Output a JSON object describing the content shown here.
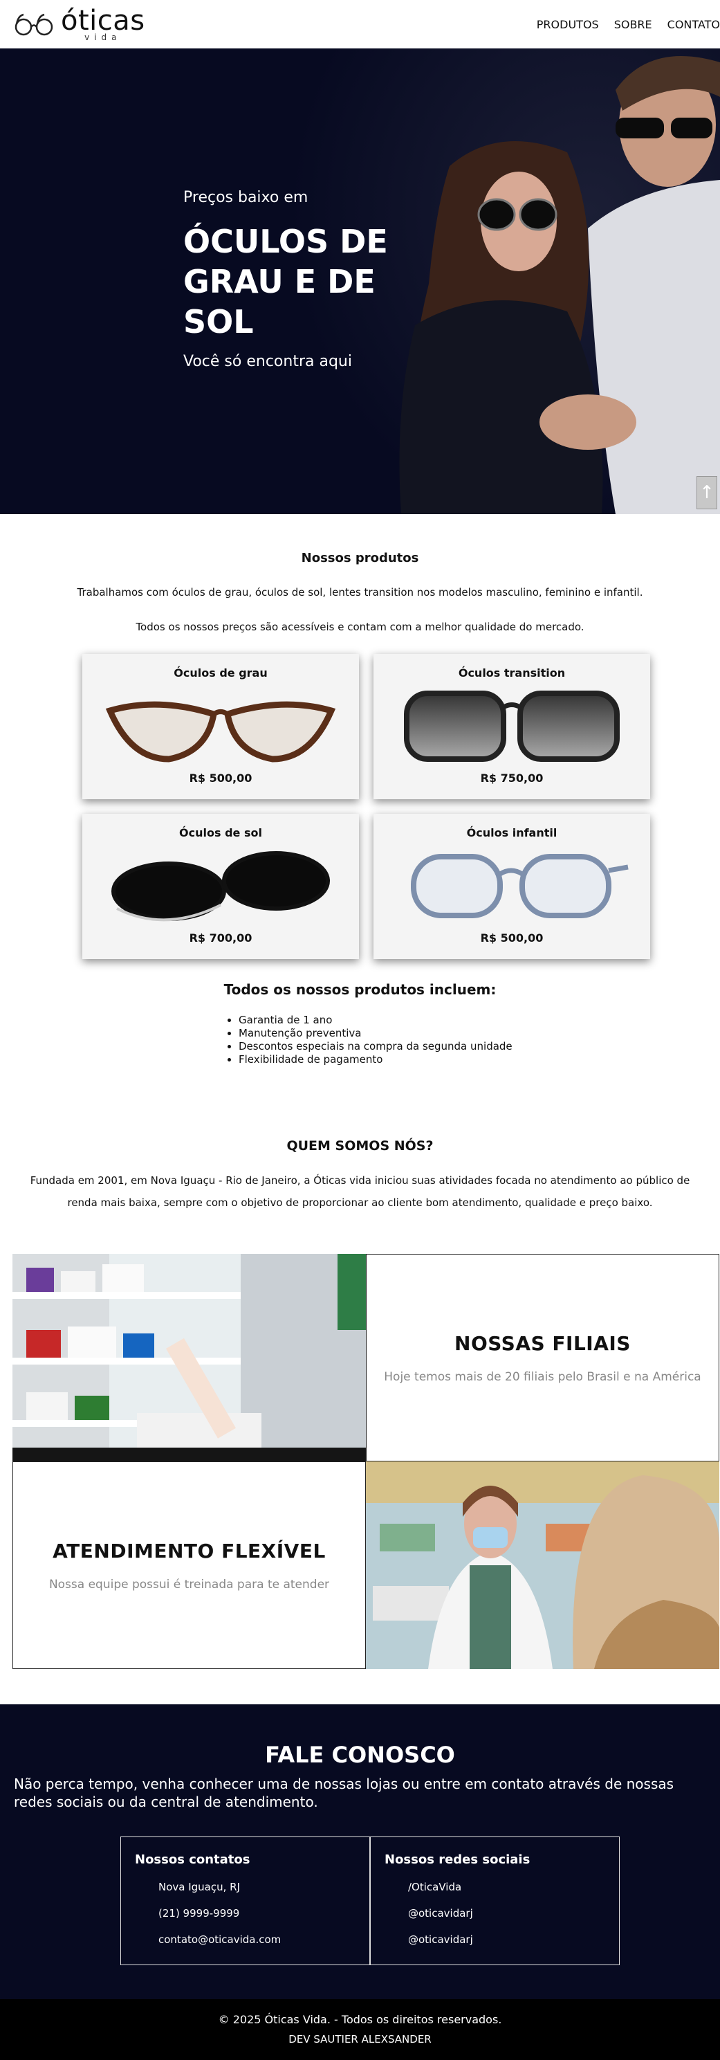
{
  "header": {
    "logo_main": "óticas",
    "logo_sub": "vida",
    "nav": [
      "PRODUTOS",
      "SOBRE",
      "CONTATO"
    ]
  },
  "hero": {
    "pre": "Preços baixo em",
    "title": "ÓCULOS DE GRAU E DE SOL",
    "sub": "Você só encontra aqui",
    "scroll_icon": "arrow-up-icon"
  },
  "products": {
    "title": "Nossos produtos",
    "text1": "Trabalhamos com óculos de grau, óculos de sol, lentes transition nos modelos masculino, feminino e infantil.",
    "text2": "Todos os nossos preços são acessíveis e contam com a melhor qualidade do mercado.",
    "cards": [
      {
        "name": "Óculos de grau",
        "price": "R$ 500,00"
      },
      {
        "name": "Óculos transition",
        "price": "R$ 750,00"
      },
      {
        "name": "Óculos de sol",
        "price": "R$ 700,00"
      },
      {
        "name": "Óculos infantil",
        "price": "R$ 500,00"
      }
    ],
    "includes_title": "Todos os nossos produtos incluem:",
    "includes": [
      "Garantia de 1 ano",
      "Manutenção preventiva",
      "Descontos especiais na compra da segunda unidade",
      "Flexibilidade de pagamento"
    ]
  },
  "about": {
    "title": "QUEM SOMOS NÓS?",
    "text": "Fundada em 2001, em Nova Iguaçu - Rio de Janeiro, a Óticas vida iniciou suas atividades focada no atendimento ao público de renda mais baixa, sempre com o objetivo de proporcionar ao cliente bom atendimento, qualidade e preço baixo."
  },
  "info": {
    "filiais_title": "NOSSAS FILIAIS",
    "filiais_text": "Hoje temos mais de 20 filiais pelo Brasil e na América",
    "atendimento_title": "ATENDIMENTO FLEXÍVEL",
    "atendimento_text": "Nossa equipe possui é treinada para te atender"
  },
  "contact": {
    "title": "FALE CONOSCO",
    "text": "Não perca tempo, venha conhecer uma de nossas lojas ou entre em contato através de nossas redes sociais ou da central de atendimento.",
    "contacts_title": "Nossos contatos",
    "contacts": [
      "Nova Iguaçu, RJ",
      "(21) 9999-9999",
      "contato@oticavida.com"
    ],
    "social_title": "Nossos redes sociais",
    "social": [
      "/OticaVida",
      "@oticavidarj",
      "@oticavidarj"
    ]
  },
  "footer": {
    "line1": "© 2025 Óticas Vida. - Todos os direitos reservados.",
    "line2": "DEV SAUTIER ALEXSANDER"
  },
  "colors": {
    "dark": "#070a21",
    "card": "#f4f4f4",
    "muted": "#888888"
  }
}
